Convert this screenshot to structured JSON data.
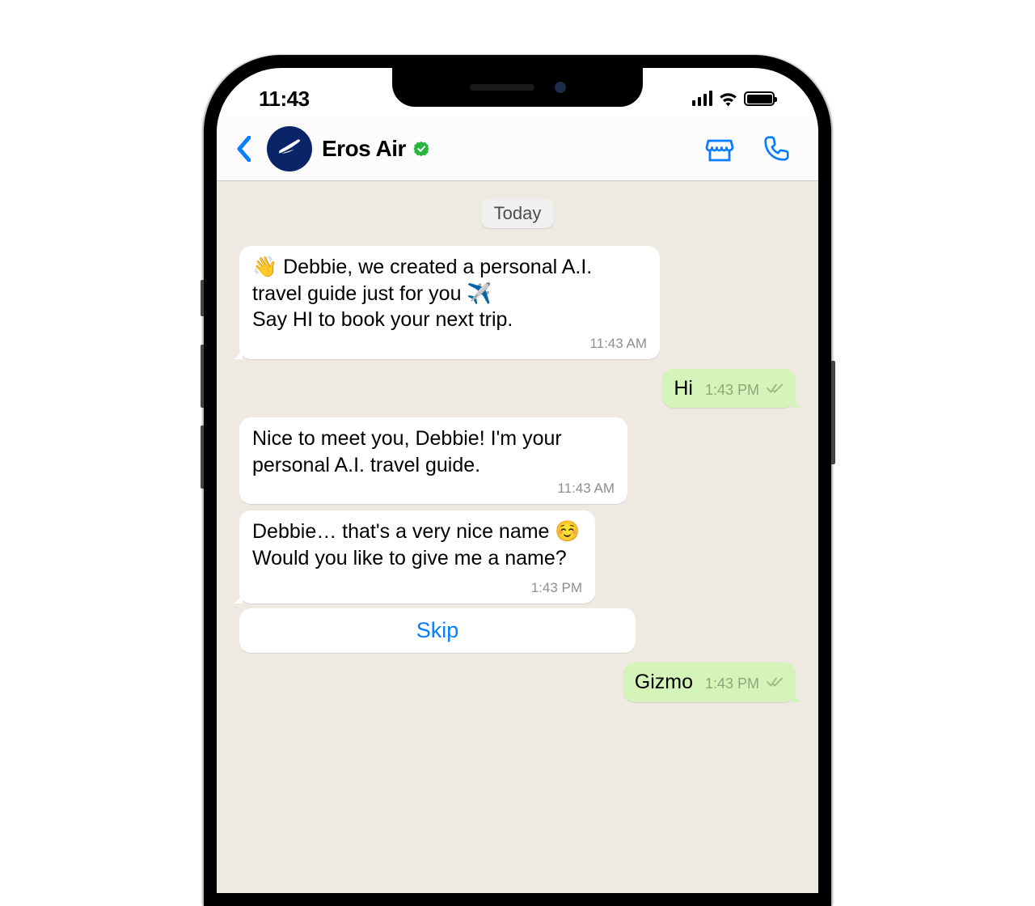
{
  "status": {
    "time": "11:43"
  },
  "header": {
    "contact_name": "Eros Air"
  },
  "chat": {
    "date_label": "Today",
    "messages": [
      {
        "direction": "in",
        "text": "👋 Debbie, we created a personal A.I. travel guide just for you ✈️\nSay HI to book your next trip.",
        "time": "11:43 AM"
      },
      {
        "direction": "out",
        "text": "Hi",
        "time": "1:43 PM"
      },
      {
        "direction": "in",
        "text": "Nice to meet you, Debbie! I'm your personal A.I. travel guide.",
        "time": "11:43 AM"
      },
      {
        "direction": "in",
        "text": "Debbie… that's a very nice name ☺️ Would you like to give me a name?",
        "time": "1:43 PM",
        "action": "Skip"
      },
      {
        "direction": "out",
        "text": "Gizmo",
        "time": "1:43 PM"
      }
    ]
  }
}
